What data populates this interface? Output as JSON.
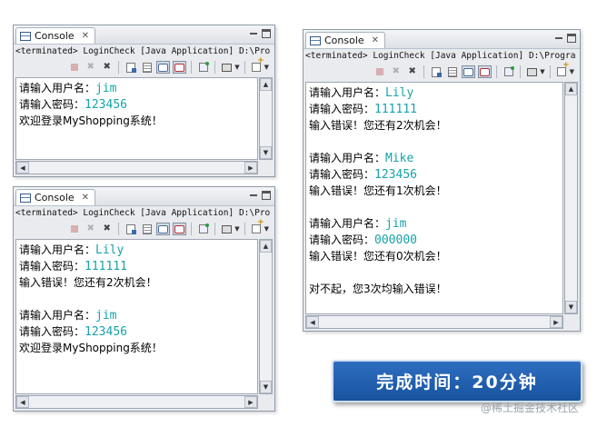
{
  "panels": [
    {
      "tab_label": "Console",
      "status": "<terminated> LoginCheck [Java Application] D:\\Pro",
      "lines": [
        {
          "label": "请输入用户名：",
          "value": "jim"
        },
        {
          "label": "请输入密码：",
          "value": "123456"
        },
        {
          "label": "欢迎登录MyShopping系统！",
          "value": ""
        }
      ]
    },
    {
      "tab_label": "Console",
      "status": "<terminated> LoginCheck [Java Application] D:\\Pro",
      "lines": [
        {
          "label": "请输入用户名：",
          "value": "Lily"
        },
        {
          "label": "请输入密码：",
          "value": "111111"
        },
        {
          "label": "输入错误！您还有2次机会！",
          "value": ""
        },
        {
          "label": "",
          "value": ""
        },
        {
          "label": "请输入用户名：",
          "value": "jim"
        },
        {
          "label": "请输入密码：",
          "value": "123456"
        },
        {
          "label": "欢迎登录MyShopping系统！",
          "value": ""
        }
      ]
    },
    {
      "tab_label": "Console",
      "status": "<terminated> LoginCheck [Java Application] D:\\Progra",
      "lines": [
        {
          "label": "请输入用户名：",
          "value": "Lily"
        },
        {
          "label": "请输入密码：",
          "value": "111111"
        },
        {
          "label": "输入错误！您还有2次机会！",
          "value": ""
        },
        {
          "label": "",
          "value": ""
        },
        {
          "label": "请输入用户名：",
          "value": "Mike"
        },
        {
          "label": "请输入密码：",
          "value": "123456"
        },
        {
          "label": "输入错误！您还有1次机会！",
          "value": ""
        },
        {
          "label": "",
          "value": ""
        },
        {
          "label": "请输入用户名：",
          "value": "jim"
        },
        {
          "label": "请输入密码：",
          "value": "000000"
        },
        {
          "label": "输入错误！您还有0次机会！",
          "value": ""
        },
        {
          "label": "",
          "value": ""
        },
        {
          "label": "对不起，您3次均输入错误！",
          "value": ""
        }
      ]
    }
  ],
  "toolbar_icons": [
    "stop-icon",
    "remove-icon",
    "remove-all-icon",
    "clear-icon",
    "scroll-lock-icon",
    "show-out-icon",
    "show-err-icon",
    "pin-icon",
    "display-icon",
    "new-console-icon"
  ],
  "banner": {
    "text": "完成时间：20分钟"
  },
  "watermark": {
    "text": "@稀土掘金技术社区"
  },
  "colors": {
    "input_value": "#17a3a8",
    "banner_bg": "#1f5fae"
  }
}
